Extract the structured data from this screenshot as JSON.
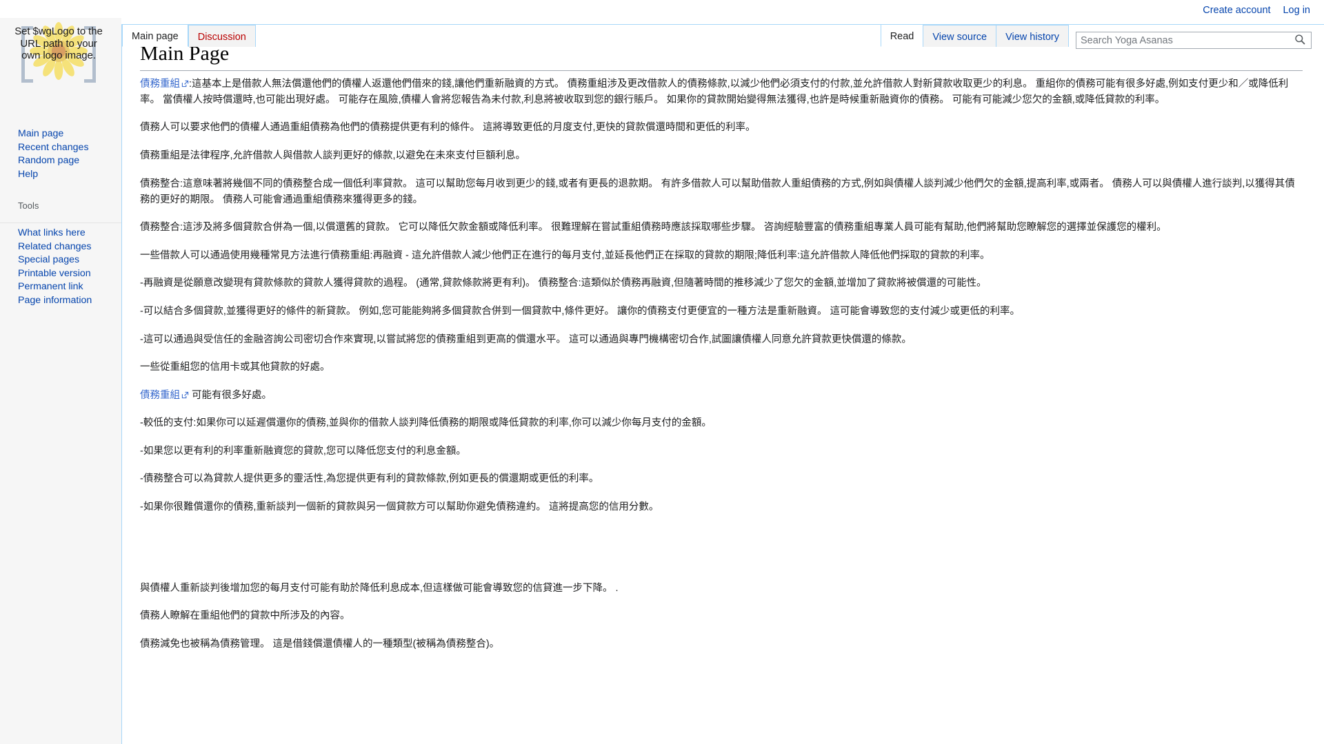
{
  "personal_bar": {
    "items": [
      {
        "label": "Create account",
        "name": "create-account-link"
      },
      {
        "label": "Log in",
        "name": "login-link"
      }
    ]
  },
  "logo": {
    "placeholder_text": "Set $wgLogo to the URL path to your own logo image."
  },
  "sidebar": {
    "navigation": {
      "heading": "",
      "items": [
        {
          "label": "Main page"
        },
        {
          "label": "Recent changes"
        },
        {
          "label": "Random page"
        },
        {
          "label": "Help"
        }
      ]
    },
    "tools": {
      "heading": "Tools",
      "items": [
        {
          "label": "What links here"
        },
        {
          "label": "Related changes"
        },
        {
          "label": "Special pages"
        },
        {
          "label": "Printable version"
        },
        {
          "label": "Permanent link"
        },
        {
          "label": "Page information"
        }
      ]
    }
  },
  "namespace_tabs": [
    {
      "label": "Main page",
      "selected": true,
      "new": false
    },
    {
      "label": "Discussion",
      "selected": false,
      "new": true
    }
  ],
  "view_tabs": [
    {
      "label": "Read",
      "selected": true
    },
    {
      "label": "View source",
      "selected": false
    },
    {
      "label": "View history",
      "selected": false
    }
  ],
  "search": {
    "placeholder": "Search Yoga Asanas",
    "value": "",
    "icon": "search-icon"
  },
  "page": {
    "title": "Main Page",
    "link_label": "債務重組",
    "paragraphs": [
      {
        "lead_link": "債務重組",
        "text": ":這基本上是借款人無法償還他們的債權人返還他們借來的錢,讓他們重新融資的方式。 債務重組涉及更改借款人的債務條款,以減少他們必須支付的付款,並允許借款人對新貸款收取更少的利息。 重組你的債務可能有很多好處,例如支付更少和／或降低利率。 當債權人按時償還時,也可能出現好處。 可能存在風險,債權人會將您報告為未付款,利息將被收取到您的銀行賬戶。 如果你的貸款開始變得無法獲得,也許是時候重新融資你的債務。 可能有可能減少您欠的金額,或降低貸款的利率。"
      },
      {
        "text": "債務人可以要求他們的債權人通過重組債務為他們的債務提供更有利的條件。 這將導致更低的月度支付,更快的貸款償還時間和更低的利率。"
      },
      {
        "text": "債務重組是法律程序,允許借款人與借款人談判更好的條款,以避免在未來支付巨額利息。"
      },
      {
        "text": "債務整合:這意味著將幾個不同的債務整合成一個低利率貸款。 這可以幫助您每月收到更少的錢,或者有更長的退款期。 有許多借款人可以幫助借款人重組債務的方式,例如與債權人談判減少他們欠的金額,提高利率,或兩者。 債務人可以與債權人進行談判,以獲得其債務的更好的期限。 債務人可能會通過重組債務來獲得更多的錢。"
      },
      {
        "text": "債務整合:這涉及將多個貸款合併為一個,以償還舊的貸款。 它可以降低欠款金額或降低利率。 很難理解在嘗試重組債務時應該採取哪些步驟。 咨詢經驗豐富的債務重組專業人員可能有幫助,他們將幫助您瞭解您的選擇並保護您的權利。"
      },
      {
        "text": "一些借款人可以通過使用幾種常見方法進行債務重組:再融資 - 這允許借款人減少他們正在進行的每月支付,並延長他們正在採取的貸款的期限;降低利率:這允許借款人降低他們採取的貸款的利率。"
      },
      {
        "text": "-再融資是從願意改變現有貸款條款的貸款人獲得貸款的過程。 (通常,貸款條款將更有利)。 債務整合:這類似於債務再融資,但隨著時間的推移減少了您欠的金額,並增加了貸款將被償還的可能性。"
      },
      {
        "text": "-可以結合多個貸款,並獲得更好的條件的新貸款。 例如,您可能能夠將多個貸款合併到一個貸款中,條件更好。 讓你的債務支付更便宜的一種方法是重新融資。 這可能會導致您的支付減少或更低的利率。"
      },
      {
        "text": "-這可以通過與受信任的金融咨詢公司密切合作來實現,以嘗試將您的債務重組到更高的償還水平。 這可以通過與專門機構密切合作,試圖讓債權人同意允許貸款更快償還的條款。"
      },
      {
        "text": "一些從重組您的信用卡或其他貸款的好處。"
      },
      {
        "lead_link": "債務重組",
        "text": " 可能有很多好處。"
      },
      {
        "text": "-較低的支付:如果你可以延遲償還你的債務,並與你的借款人談判降低債務的期限或降低貸款的利率,你可以減少你每月支付的金額。"
      },
      {
        "text": "-如果您以更有利的利率重新融資您的貸款,您可以降低您支付的利息金額。"
      },
      {
        "text": "-債務整合可以為貸款人提供更多的靈活性,為您提供更有利的貸款條款,例如更長的償還期或更低的利率。"
      },
      {
        "text": "-如果你很難償還你的債務,重新談判一個新的貸款與另一個貸款方可以幫助你避免債務違約。 這將提高您的信用分數。"
      },
      {
        "text": "與債權人重新談判後增加您的每月支付可能有助於降低利息成本,但這樣做可能會導致您的信貸進一步下降。 ."
      },
      {
        "text": "債務人瞭解在重組他們的貸款中所涉及的內容。"
      },
      {
        "text": "債務減免也被稱為債務管理。 這是借錢償還債權人的一種類型(被稱為債務整合)。"
      }
    ]
  },
  "colors": {
    "link": "#0645ad",
    "ext_link": "#3366cc",
    "new_link": "#ba0000",
    "tab_border": "#a7d7f9",
    "sidebar_bg": "#f6f6f6",
    "text": "#202122"
  }
}
